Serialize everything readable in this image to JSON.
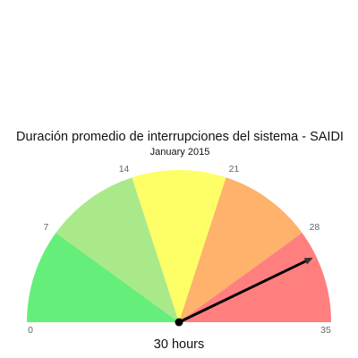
{
  "chart_data": {
    "type": "gauge",
    "title": "Duración promedio de interrupciones del sistema - SAIDI",
    "subtitle": "January 2015",
    "min": 0,
    "max": 35,
    "value": 30,
    "value_label": "30 hours",
    "ticks": [
      {
        "value": 0,
        "label": "0"
      },
      {
        "value": 7,
        "label": "7"
      },
      {
        "value": 14,
        "label": "14"
      },
      {
        "value": 21,
        "label": "21"
      },
      {
        "value": 28,
        "label": "28"
      },
      {
        "value": 35,
        "label": "35"
      }
    ],
    "bands": [
      {
        "from": 0,
        "to": 7,
        "color": "#66ee7a"
      },
      {
        "from": 7,
        "to": 14,
        "color": "#a9e98a"
      },
      {
        "from": 14,
        "to": 21,
        "color": "#fefe66"
      },
      {
        "from": 21,
        "to": 28,
        "color": "#feb26b"
      },
      {
        "from": 28,
        "to": 35,
        "color": "#ff7f7f"
      }
    ],
    "needle_color": "#000000"
  }
}
